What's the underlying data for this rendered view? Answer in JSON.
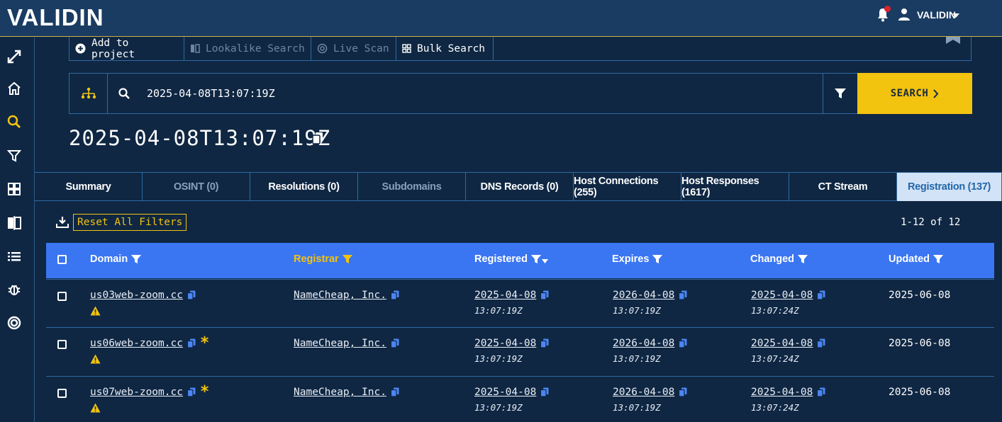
{
  "app": {
    "logo": "VALIDIN",
    "user": "VALIDIN"
  },
  "toolbar": {
    "add_project": "Add to project",
    "lookalike": "Lookalike Search",
    "live_scan": "Live Scan",
    "bulk_search": "Bulk Search"
  },
  "search": {
    "value": "2025-04-08T13:07:19Z",
    "button": "SEARCH"
  },
  "page_title": "2025-04-08T13:07:19Z",
  "tabs": [
    {
      "label": "Summary"
    },
    {
      "label": "OSINT (0)"
    },
    {
      "label": "Resolutions (0)"
    },
    {
      "label": "Subdomains"
    },
    {
      "label": "DNS Records (0)"
    },
    {
      "label": "Host Connections (255)"
    },
    {
      "label": "Host Responses (1617)"
    },
    {
      "label": "CT Stream"
    },
    {
      "label": "Registration (137)"
    }
  ],
  "filters": {
    "reset": "Reset All Filters",
    "count": "1-12 of 12"
  },
  "table": {
    "headers": {
      "domain": "Domain",
      "registrar": "Registrar",
      "registered": "Registered",
      "expires": "Expires",
      "changed": "Changed",
      "updated": "Updated"
    },
    "rows": [
      {
        "domain": "us03web-zoom.cc",
        "registrar": "NameCheap, Inc.",
        "registered_date": "2025-04-08",
        "registered_time": "13:07:19Z",
        "expires_date": "2026-04-08",
        "expires_time": "13:07:19Z",
        "changed_date": "2025-04-08",
        "changed_time": "13:07:24Z",
        "updated": "2025-06-08",
        "starred": false
      },
      {
        "domain": "us06web-zoom.cc",
        "registrar": "NameCheap, Inc.",
        "registered_date": "2025-04-08",
        "registered_time": "13:07:19Z",
        "expires_date": "2026-04-08",
        "expires_time": "13:07:19Z",
        "changed_date": "2025-04-08",
        "changed_time": "13:07:24Z",
        "updated": "2025-06-08",
        "starred": true
      },
      {
        "domain": "us07web-zoom.cc",
        "registrar": "NameCheap, Inc.",
        "registered_date": "2025-04-08",
        "registered_time": "13:07:19Z",
        "expires_date": "2026-04-08",
        "expires_time": "13:07:19Z",
        "changed_date": "2025-04-08",
        "changed_time": "13:07:24Z",
        "updated": "2025-06-08",
        "starred": true
      }
    ]
  },
  "colors": {
    "background": "#0f2743",
    "topbar": "#1a3c62",
    "accent": "#f2c30f",
    "table_header": "#3b76f2",
    "active_tab": "#d3e3f7"
  }
}
